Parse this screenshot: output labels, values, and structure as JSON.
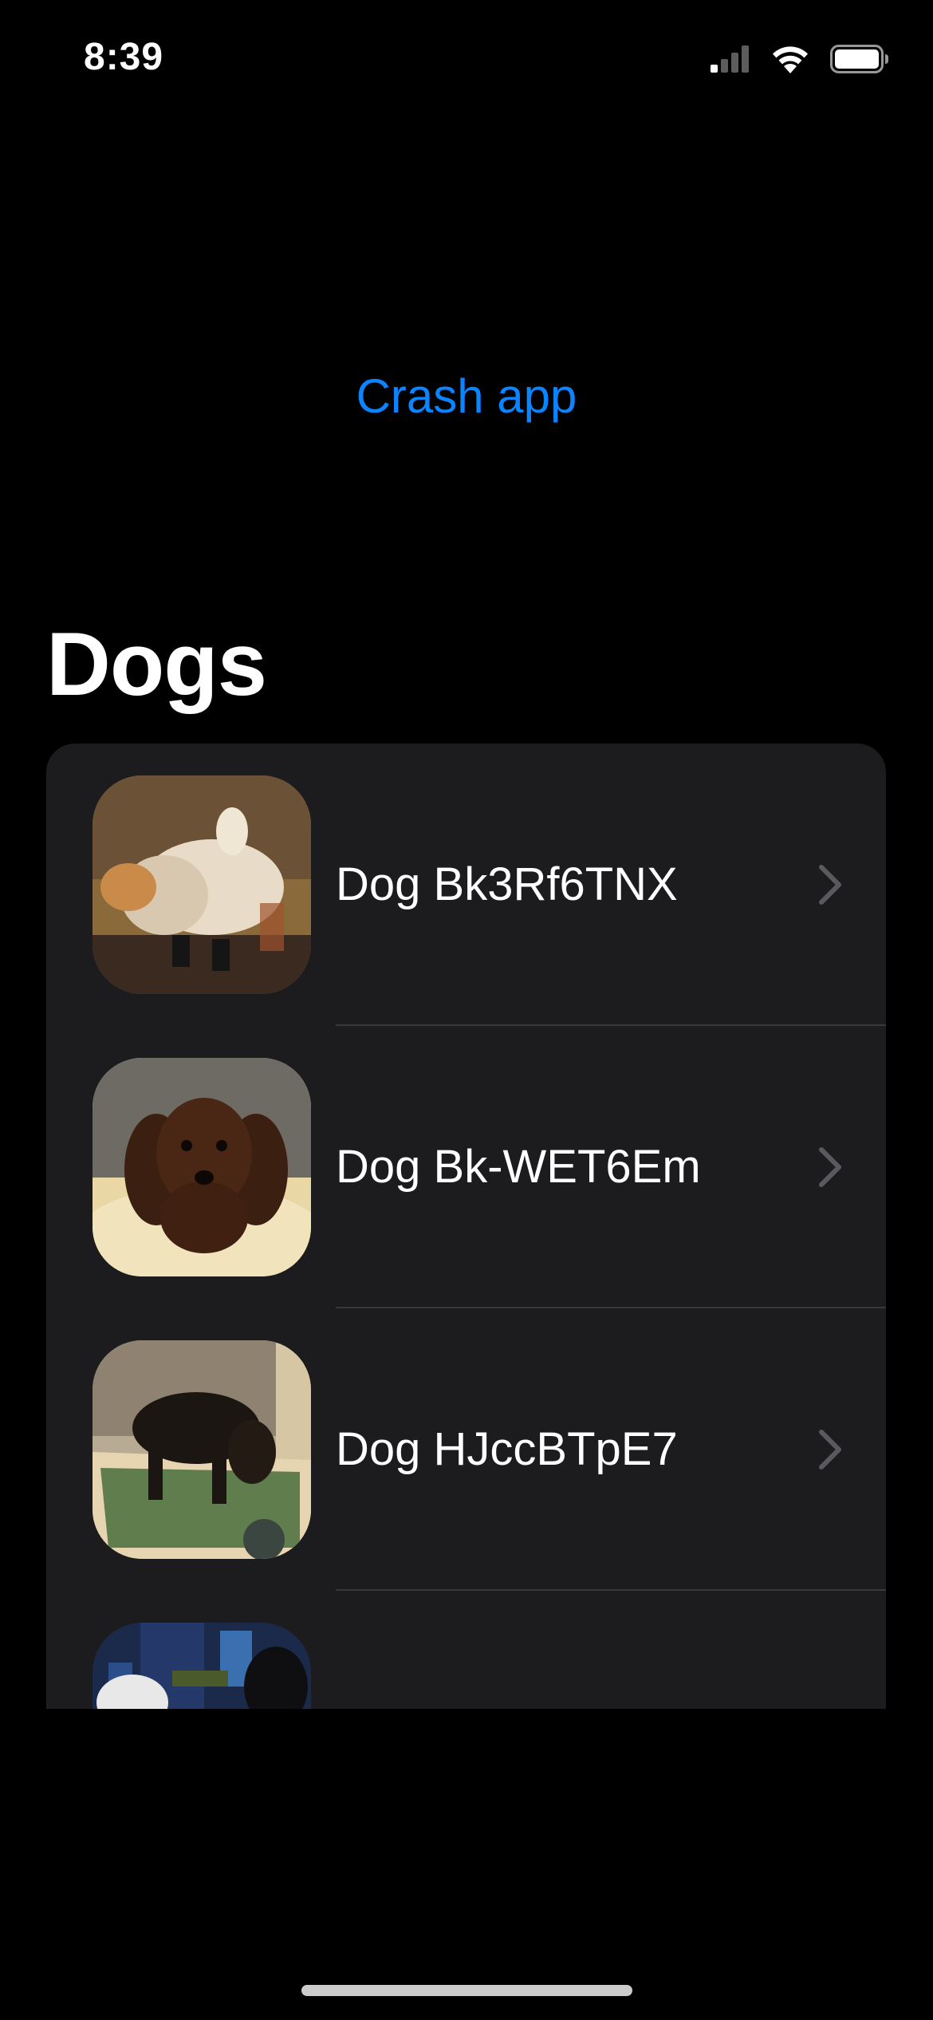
{
  "status_bar": {
    "time": "8:39",
    "icons": [
      "cellular-signal-icon",
      "wifi-icon",
      "battery-icon"
    ]
  },
  "crash_button": {
    "label": "Crash app",
    "color": "#0a84ff"
  },
  "list": {
    "title": "Dogs",
    "rows": [
      {
        "label": "Dog Bk3Rf6TNX",
        "icon": "chevron-right-icon"
      },
      {
        "label": "Dog Bk-WET6Em",
        "icon": "chevron-right-icon"
      },
      {
        "label": "Dog HJccBTpE7",
        "icon": "chevron-right-icon"
      },
      {
        "label": "",
        "icon": ""
      }
    ]
  },
  "colors": {
    "background": "#000000",
    "card": "#1c1c1e",
    "separator": "#38383a",
    "accent": "#0a84ff",
    "chevron": "#5a5a5e"
  }
}
